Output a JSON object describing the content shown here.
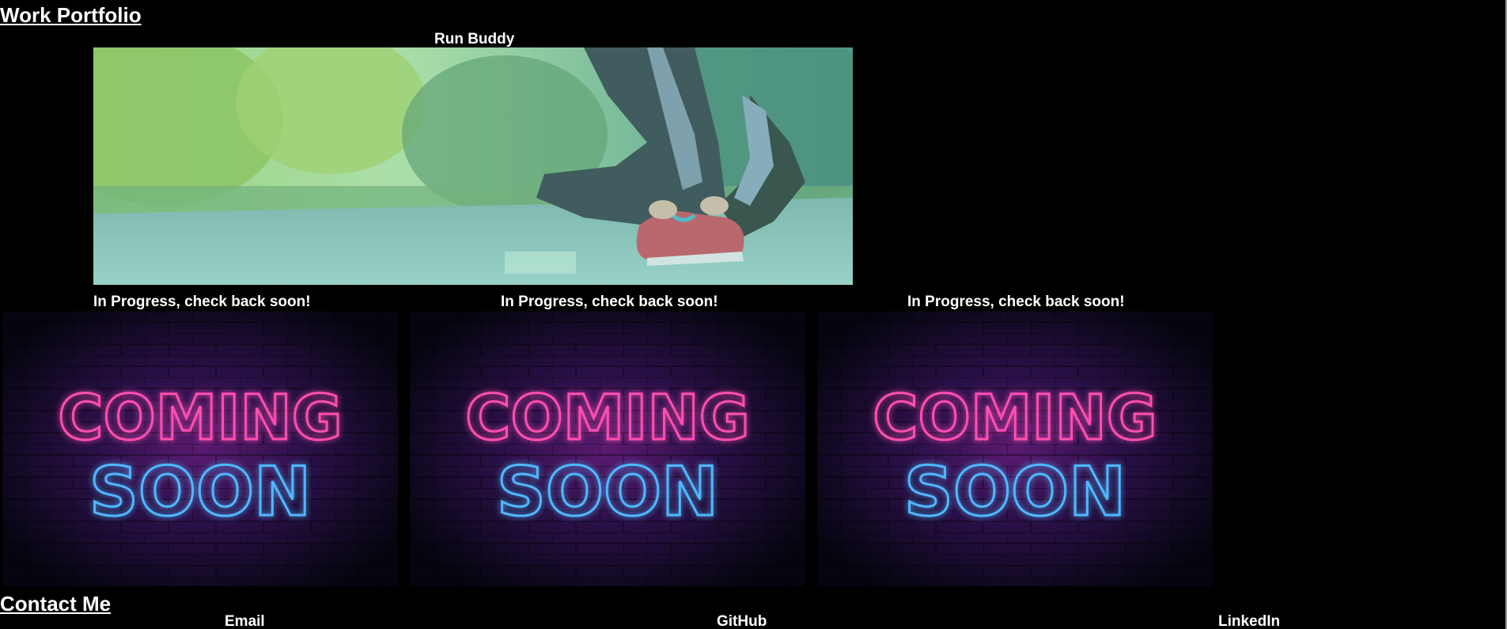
{
  "portfolio": {
    "heading": "Work Portfolio",
    "featured": {
      "title": "Run Buddy",
      "image_icon": "runner-tying-shoe-photo"
    },
    "cards": [
      {
        "caption": "In Progress, check back soon!",
        "line1": "COMING",
        "line2": "SOON"
      },
      {
        "caption": "In Progress, check back soon!",
        "line1": "COMING",
        "line2": "SOON"
      },
      {
        "caption": "In Progress, check back soon!",
        "line1": "COMING",
        "line2": "SOON"
      }
    ]
  },
  "contact": {
    "heading": "Contact Me",
    "links": {
      "email": "Email",
      "github": "GitHub",
      "linkedin": "LinkedIn"
    }
  },
  "colors": {
    "background": "#000000",
    "text": "#ffffff",
    "neon_pink": "#ff4fb0",
    "neon_blue": "#4fb8ff",
    "featured_overlay": "#7fd6c9"
  }
}
